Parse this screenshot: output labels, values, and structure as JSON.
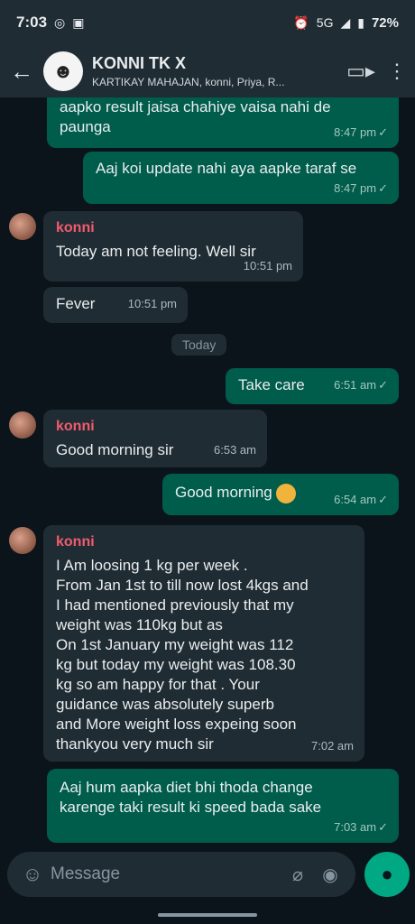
{
  "status": {
    "time": "7:03",
    "battery": "72%",
    "network": "5G"
  },
  "header": {
    "title": "KONNI TK X",
    "subtitle": "KARTIKAY MAHAJAN, konni, Priya, R..."
  },
  "messages": {
    "m0": {
      "text": "aapko result jaisa chahiye vaisa nahi de\npaunga",
      "time": "8:47 pm"
    },
    "m1": {
      "text": "Aaj koi update nahi aya aapke taraf se",
      "time": "8:47 pm"
    },
    "m2": {
      "sender": "konni",
      "text": "Today am not feeling. Well sir",
      "time": "10:51 pm"
    },
    "m3": {
      "text": "Fever",
      "time": "10:51 pm"
    },
    "date_separator": "Today",
    "m4": {
      "text": "Take care",
      "time": "6:51 am"
    },
    "m5": {
      "sender": "konni",
      "text": "Good morning sir",
      "time": "6:53 am"
    },
    "m6": {
      "text": "Good morning",
      "time": "6:54 am"
    },
    "m7": {
      "sender": "konni",
      "text": "I Am loosing 1 kg per week .\nFrom Jan 1st to till now lost 4kgs and\nI had mentioned previously that my\nweight was 110kg  but as\nOn 1st January my weight was 112\nkg but today my weight was 108.30\nkg so am happy for that . Your\nguidance was absolutely superb\nand More weight loss expeing soon\nthankyou very much sir",
      "time": "7:02 am"
    },
    "m8": {
      "text": "Aaj hum aapka diet bhi thoda change\nkarenge taki result ki speed bada sake",
      "time": "7:03 am"
    }
  },
  "composer": {
    "placeholder": "Message"
  },
  "icons": {
    "back": "arrow-left",
    "video": "video-call",
    "menu": "more-vert",
    "emoji": "sticker",
    "attach": "paperclip",
    "camera": "camera",
    "mic": "microphone"
  },
  "colors": {
    "outgoing": "#005c4b",
    "incoming": "#202c33",
    "sender_name": "#f15c6d",
    "accent": "#00a884"
  }
}
